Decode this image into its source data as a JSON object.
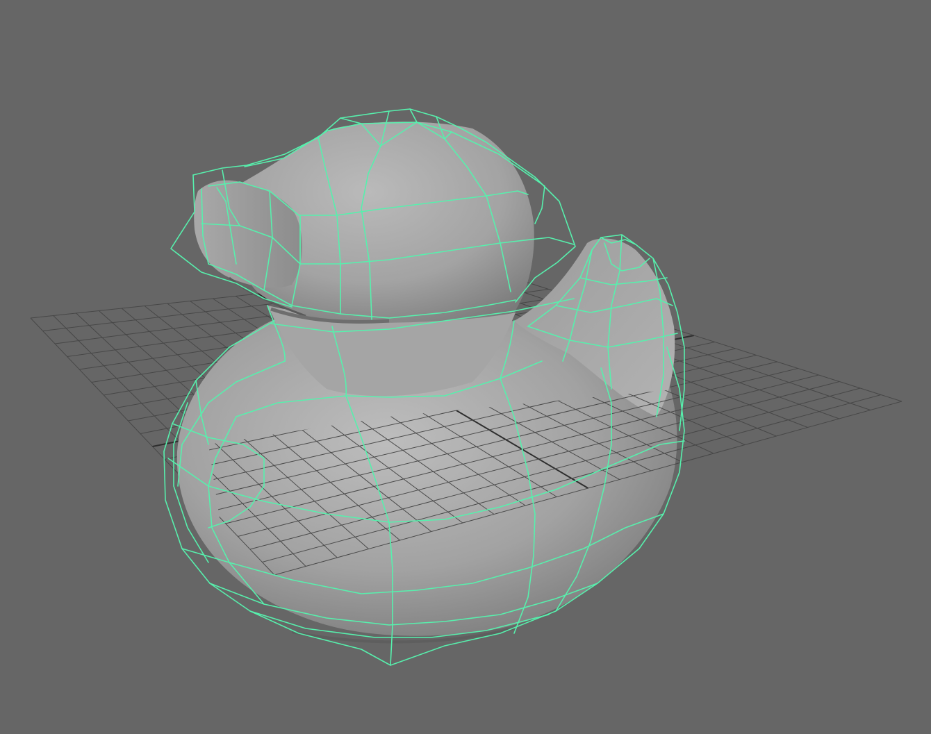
{
  "viewport": {
    "background_color": "#666666",
    "grid_color": "#474747",
    "grid_axis_color": "#2e2e2e",
    "mesh_base_color": "#a6a6a6",
    "mesh_shadow_color": "#6e6e6e",
    "wire_color": "#57f0ad"
  },
  "scene": {
    "object": "rubber-duck",
    "display_mode": "smooth-mesh-with-cage-wireframe",
    "grid_visible": true
  }
}
